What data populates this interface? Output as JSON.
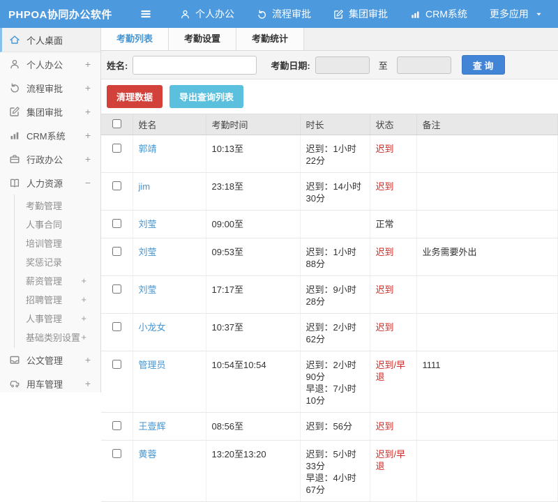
{
  "navbar": {
    "brand": "PHPOA协同办公软件",
    "items": [
      {
        "label": "个人办公",
        "icon": "user-icon",
        "caret": false
      },
      {
        "label": "流程审批",
        "icon": "flow-icon",
        "caret": false
      },
      {
        "label": "集团审批",
        "icon": "edit-icon",
        "caret": false
      },
      {
        "label": "CRM系统",
        "icon": "chart-icon",
        "caret": false
      },
      {
        "label": "更多应用",
        "icon": "",
        "caret": true
      }
    ]
  },
  "sidebar": {
    "items": [
      {
        "label": "个人桌面",
        "icon": "home-icon",
        "expand": "",
        "active": true,
        "children": []
      },
      {
        "label": "个人办公",
        "icon": "user-icon",
        "expand": "+",
        "active": false,
        "children": []
      },
      {
        "label": "流程审批",
        "icon": "flow-icon",
        "expand": "+",
        "active": false,
        "children": []
      },
      {
        "label": "集团审批",
        "icon": "edit-icon",
        "expand": "+",
        "active": false,
        "children": []
      },
      {
        "label": "CRM系统",
        "icon": "chart-icon",
        "expand": "+",
        "active": false,
        "children": []
      },
      {
        "label": "行政办公",
        "icon": "briefcase-icon",
        "expand": "+",
        "active": false,
        "children": []
      },
      {
        "label": "人力资源",
        "icon": "book-icon",
        "expand": "−",
        "active": false,
        "children": [
          {
            "label": "考勤管理",
            "expand": ""
          },
          {
            "label": "人事合同",
            "expand": ""
          },
          {
            "label": "培训管理",
            "expand": ""
          },
          {
            "label": "奖惩记录",
            "expand": ""
          },
          {
            "label": "薪资管理",
            "expand": "+"
          },
          {
            "label": "招聘管理",
            "expand": "+"
          },
          {
            "label": "人事管理",
            "expand": "+"
          },
          {
            "label": "基础类别设置",
            "expand": "+"
          }
        ]
      },
      {
        "label": "公文管理",
        "icon": "doc-icon",
        "expand": "+",
        "active": false,
        "children": []
      },
      {
        "label": "用车管理",
        "icon": "car-icon",
        "expand": "+",
        "active": false,
        "children": []
      }
    ]
  },
  "tabs": [
    {
      "label": "考勤列表",
      "active": true
    },
    {
      "label": "考勤设置",
      "active": false
    },
    {
      "label": "考勤统计",
      "active": false
    }
  ],
  "search": {
    "name_label": "姓名:",
    "name_value": "",
    "date_label": "考勤日期:",
    "date_from": "",
    "to_label": "至",
    "date_to": "",
    "query_button": "查 询"
  },
  "actions": {
    "clean_button": "清理数据",
    "export_button": "导出查询列表"
  },
  "table": {
    "headers": [
      "姓名",
      "考勤时间",
      "时长",
      "状态",
      "备注"
    ],
    "rows": [
      {
        "name": "郭靖",
        "time": "10:13至",
        "duration": [
          "迟到：1小时22分"
        ],
        "status": "迟到",
        "status_type": "late",
        "remark": ""
      },
      {
        "name": "jim",
        "time": "23:18至",
        "duration": [
          "迟到：14小时30分"
        ],
        "status": "迟到",
        "status_type": "late",
        "remark": ""
      },
      {
        "name": "刘莹",
        "time": "09:00至",
        "duration": [],
        "status": "正常",
        "status_type": "normal",
        "remark": ""
      },
      {
        "name": "刘莹",
        "time": "09:53至",
        "duration": [
          "迟到：1小时88分"
        ],
        "status": "迟到",
        "status_type": "late",
        "remark": "业务需要外出"
      },
      {
        "name": "刘莹",
        "time": "17:17至",
        "duration": [
          "迟到：9小时28分"
        ],
        "status": "迟到",
        "status_type": "late",
        "remark": ""
      },
      {
        "name": "小龙女",
        "time": "10:37至",
        "duration": [
          "迟到：2小时62分"
        ],
        "status": "迟到",
        "status_type": "late",
        "remark": ""
      },
      {
        "name": "管理员",
        "time": "10:54至10:54",
        "duration": [
          "迟到：2小时90分",
          "早退：7小时10分"
        ],
        "status": "迟到/早退",
        "status_type": "late",
        "remark": "1111"
      },
      {
        "name": "王壹辉",
        "time": "08:56至",
        "duration": [
          "迟到：56分"
        ],
        "status": "迟到",
        "status_type": "late",
        "remark": ""
      },
      {
        "name": "黄蓉",
        "time": "13:20至13:20",
        "duration": [
          "迟到：5小时33分",
          "早退：4小时67分"
        ],
        "status": "迟到/早退",
        "status_type": "late",
        "remark": ""
      }
    ]
  },
  "colors": {
    "navbar_bg": "#4c99dd",
    "accent_blue": "#4596d2",
    "query_button_bg": "#4285d7",
    "danger_red": "#d2413a",
    "info_teal": "#5bc0de",
    "status_red": "#cc2b27",
    "sidebar_active_border": "#85c1ea"
  }
}
